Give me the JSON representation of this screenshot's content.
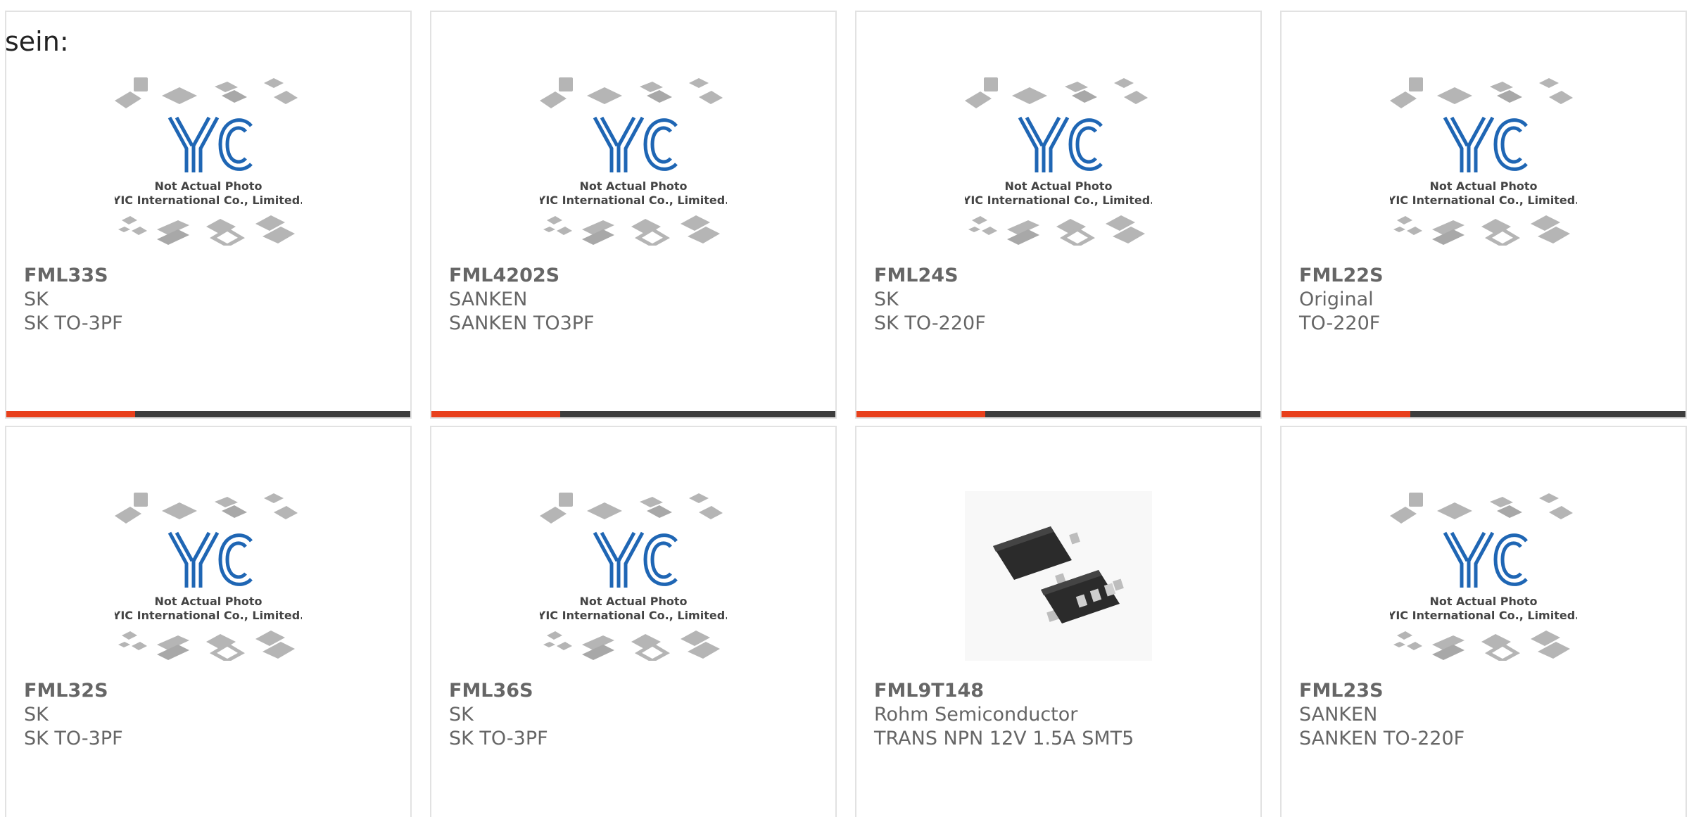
{
  "lead_text": "sein:",
  "accent_color": "#e8401c",
  "bar_color": "#3d3d3d",
  "placeholder": {
    "line1": "Not Actual Photo",
    "line2": "YIC International Co., Limited."
  },
  "products": [
    {
      "part": "FML33S",
      "brand": "SK",
      "desc": "SK TO-3PF",
      "image": "placeholder-logo"
    },
    {
      "part": "FML4202S",
      "brand": "SANKEN",
      "desc": "SANKEN TO3PF",
      "image": "placeholder-logo"
    },
    {
      "part": "FML24S",
      "brand": "SK",
      "desc": "SK TO-220F",
      "image": "placeholder-logo"
    },
    {
      "part": "FML22S",
      "brand": "Original",
      "desc": "TO-220F",
      "image": "placeholder-logo"
    },
    {
      "part": "FML32S",
      "brand": "SK",
      "desc": "SK TO-3PF",
      "image": "placeholder-logo"
    },
    {
      "part": "FML36S",
      "brand": "SK",
      "desc": "SK TO-3PF",
      "image": "placeholder-logo"
    },
    {
      "part": "FML9T148",
      "brand": "Rohm Semiconductor",
      "desc": "TRANS NPN 12V 1.5A SMT5",
      "image": "component-photo"
    },
    {
      "part": "FML23S",
      "brand": "SANKEN",
      "desc": "SANKEN TO-220F",
      "image": "placeholder-logo"
    }
  ]
}
